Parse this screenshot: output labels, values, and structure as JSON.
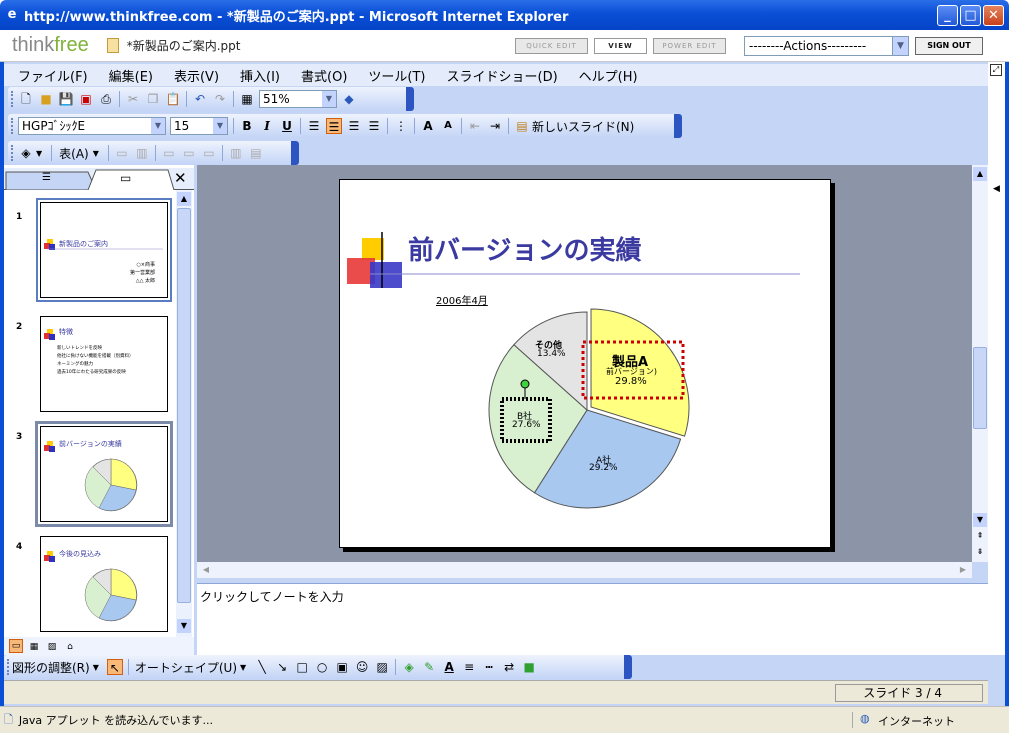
{
  "window": {
    "title": "http://www.thinkfree.com - *新製品のご案内.ppt - Microsoft Internet Explorer"
  },
  "app": {
    "logo_a": "think",
    "logo_b": "free",
    "filename": "*新製品のご案内.ppt",
    "quick_edit": "QUICK EDIT",
    "view": "VIEW",
    "power_edit": "POWER EDIT",
    "actions": "--------Actions---------",
    "sign_out": "SIGN OUT"
  },
  "menu": [
    "ファイル(F)",
    "編集(E)",
    "表示(V)",
    "挿入(I)",
    "書式(O)",
    "ツール(T)",
    "スライドショー(D)",
    "ヘルプ(H)"
  ],
  "toolbar": {
    "zoom": "51%",
    "font": "HGPｺﾞｼｯｸE",
    "size": "15",
    "bold": "B",
    "italic": "I",
    "underline": "U",
    "new_slide": "新しいスライド(N)",
    "table": "表(A)"
  },
  "thumbs": [
    {
      "num": "1",
      "title": "新製品のご案内",
      "l1": "○×商事",
      "l2": "第一営業部",
      "l3": "△△ 太郎"
    },
    {
      "num": "2",
      "title": "特徴",
      "b1": "新しいトレンドを反映",
      "b2": "他社に負けない機能を搭載（別資料）",
      "b3": "ネーミングの魅力",
      "b4": "過去10年にわたる研究成果の反映"
    },
    {
      "num": "3",
      "title": "前バージョンの実績"
    },
    {
      "num": "4",
      "title": "今後の見込み"
    }
  ],
  "slide": {
    "title": "前バージョンの実績",
    "date": "2006年4月"
  },
  "chart_data": {
    "type": "pie",
    "title": "",
    "categories": [
      "製品A（前バージョン）",
      "A社",
      "B社",
      "その他"
    ],
    "values": [
      29.8,
      29.2,
      27.6,
      13.4
    ],
    "labels": {
      "a1": "製品A",
      "a2": "前バージョン)",
      "a3": "29.8%",
      "b1": "A社",
      "b2": "29.2%",
      "c1": "B社",
      "c2": "27.6%",
      "d1": "その他",
      "d2": "13.4%"
    },
    "colors": [
      "#ffff80",
      "#a8c8f0",
      "#d8f0d0",
      "#e4e4e4"
    ]
  },
  "notes": {
    "placeholder": "クリックしてノートを入力"
  },
  "drawbar": {
    "adjust": "図形の調整(R)",
    "autoshape": "オートシェイプ(U)"
  },
  "status": {
    "slide_count": "スライド 3 / 4",
    "applet": "Java アプレット を読み込んでいます...",
    "zone": "インターネット"
  }
}
